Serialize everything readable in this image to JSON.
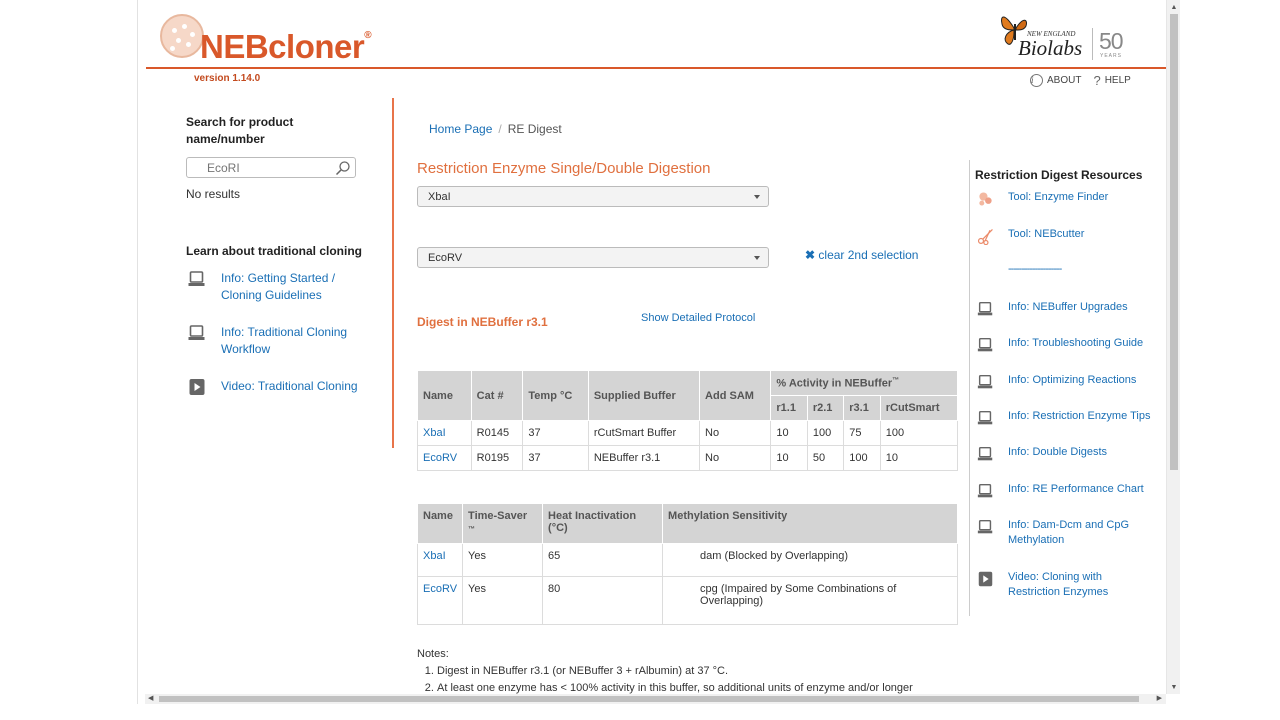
{
  "brand": {
    "app_name": "NEBcloner",
    "reg_mark": "®",
    "version": "version 1.14.0",
    "company_small": "NEW ENGLAND",
    "company_big": "Biolabs",
    "anniversary": "50",
    "anniversary_sub": "YEARS",
    "accent": "#d9582a"
  },
  "top_links": [
    {
      "label": "ABOUT",
      "icon": "info-icon"
    },
    {
      "label": "HELP",
      "icon": "question-icon"
    }
  ],
  "sidebar": {
    "search_heading": "Search for product name/number",
    "search_placeholder": "EcoRI",
    "search_results": "No results",
    "learn_heading": "Learn about traditional cloning",
    "items": [
      {
        "label": "Info: Getting Started / Cloning Guidelines",
        "icon": "laptop-icon"
      },
      {
        "label": "Info: Traditional Cloning Workflow",
        "icon": "laptop-icon"
      },
      {
        "label": "Video: Traditional Cloning",
        "icon": "play-icon"
      }
    ]
  },
  "breadcrumb": {
    "home": "Home Page",
    "separator": "/",
    "current": "RE Digest"
  },
  "main": {
    "title": "Restriction Enzyme Single/Double Digestion",
    "enzyme1": "XbaI",
    "enzyme2": "EcoRV",
    "clear_label": "clear 2nd selection",
    "digest_title": "Digest in NEBuffer r3.1",
    "protocol_link": "Show Detailed Protocol"
  },
  "table1": {
    "headers": [
      "Name",
      "Cat #",
      "Temp °C",
      "Supplied Buffer",
      "Add SAM"
    ],
    "activity_header": "% Activity in NEBuffer",
    "activity_tm": "™",
    "activity_cols": [
      "r1.1",
      "r2.1",
      "r3.1",
      "rCutSmart"
    ],
    "rows": [
      {
        "name": "XbaI",
        "cat": "R0145",
        "temp": "37",
        "buffer": "rCutSmart Buffer",
        "sam": "No",
        "a": [
          "10",
          "100",
          "75",
          "100"
        ]
      },
      {
        "name": "EcoRV",
        "cat": "R0195",
        "temp": "37",
        "buffer": "NEBuffer r3.1",
        "sam": "No",
        "a": [
          "10",
          "50",
          "100",
          "10"
        ]
      }
    ]
  },
  "table2": {
    "headers": [
      "Name",
      "Time-Saver",
      "Heat Inactivation (°C)",
      "Methylation Sensitivity"
    ],
    "timesaver_tm": "™",
    "rows": [
      {
        "name": "XbaI",
        "ts": "Yes",
        "heat": "65",
        "meth": "dam (Blocked by Overlapping)"
      },
      {
        "name": "EcoRV",
        "ts": "Yes",
        "heat": "80",
        "meth": "cpg (Impaired by Some Combinations of Overlapping)"
      }
    ]
  },
  "notes": {
    "heading": "Notes:",
    "items": [
      "Digest in NEBuffer r3.1 (or NEBuffer 3 + rAlbumin) at 37 °C.",
      "At least one enzyme has < 100% activity in this buffer, so additional units of enzyme and/or longer"
    ]
  },
  "resources": {
    "heading": "Restriction Digest Resources",
    "items": [
      {
        "label": "Tool: Enzyme Finder",
        "icon": "enzyme-finder-icon"
      },
      {
        "label": "Tool: NEBcutter",
        "icon": "scissors-icon"
      },
      {
        "label": "--------------------",
        "icon": ""
      },
      {
        "label": "Info: NEBuffer Upgrades",
        "icon": "laptop-icon"
      },
      {
        "label": "Info: Troubleshooting Guide",
        "icon": "laptop-icon"
      },
      {
        "label": "Info: Optimizing Reactions",
        "icon": "laptop-icon"
      },
      {
        "label": "Info: Restriction Enzyme Tips",
        "icon": "laptop-icon"
      },
      {
        "label": "Info: Double Digests",
        "icon": "laptop-icon"
      },
      {
        "label": "Info: RE Performance Chart",
        "icon": "laptop-icon"
      },
      {
        "label": "Info: Dam-Dcm and CpG Methylation",
        "icon": "laptop-icon"
      },
      {
        "label": "Video: Cloning with Restriction Enzymes",
        "icon": "play-icon"
      }
    ]
  }
}
